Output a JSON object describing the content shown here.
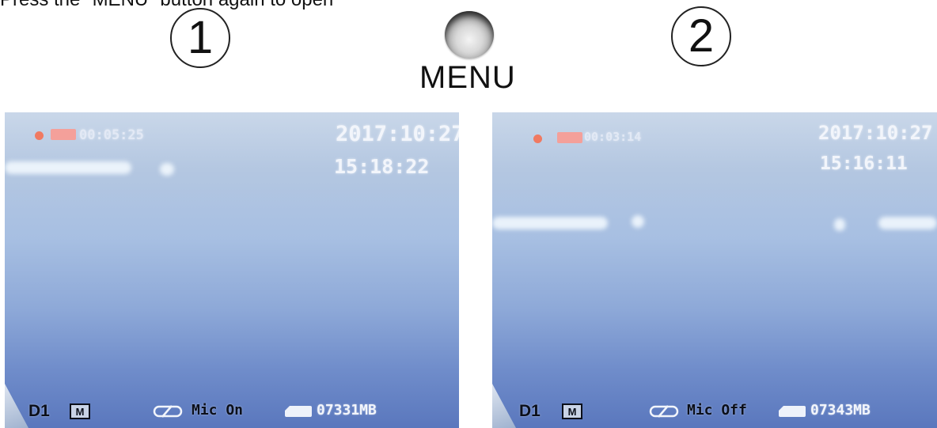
{
  "instruction": "Press the \"MENU\" button again to open",
  "steps": [
    "1",
    "2"
  ],
  "menu_button": {
    "label": "MENU"
  },
  "screens": [
    {
      "elapsed": "00:05:25",
      "date": "2017:10:27",
      "time": "15:18:22",
      "resolution": "D1",
      "mode": "M",
      "mic": "Mic On",
      "storage": "07331MB"
    },
    {
      "elapsed": "00:03:14",
      "date": "2017:10:27",
      "time": "15:16:11",
      "resolution": "D1",
      "mode": "M",
      "mic": "Mic Off",
      "storage": "07343MB"
    }
  ],
  "colors": {
    "rec_indicator": "#f07a62",
    "screen_top": "#c9d7e9",
    "screen_bottom": "#5a77bd"
  }
}
